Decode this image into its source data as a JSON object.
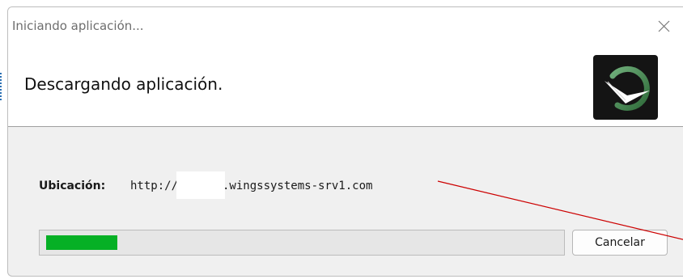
{
  "window": {
    "title": "Iniciando aplicación...",
    "close_icon": "close-icon"
  },
  "header": {
    "title": "Descargando aplicación.",
    "logo_icon": "app-logo-checkmark-icon"
  },
  "location": {
    "label": "Ubicación:",
    "url_prefix": "http://",
    "url_suffix": ".wingssystems-srv1.com"
  },
  "progress": {
    "value_percent": 14,
    "fill_color": "#06b025"
  },
  "buttons": {
    "cancel_label": "Cancelar"
  },
  "annotation": {
    "line_color": "#cc0000"
  }
}
